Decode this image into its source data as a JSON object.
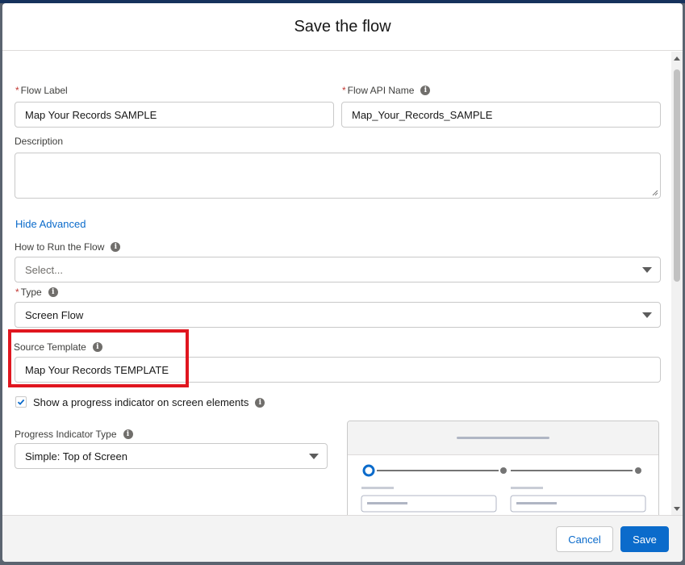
{
  "modal": {
    "title": "Save the flow"
  },
  "form": {
    "flow_label": {
      "label": "Flow Label",
      "required_marker": "*",
      "value": "Map Your Records SAMPLE"
    },
    "flow_api_name": {
      "label": "Flow API Name",
      "required_marker": "*",
      "value": "Map_Your_Records_SAMPLE"
    },
    "description": {
      "label": "Description",
      "value": ""
    },
    "advanced_link": "Hide Advanced",
    "how_to_run": {
      "label": "How to Run the Flow",
      "placeholder": "Select..."
    },
    "type": {
      "label": "Type",
      "required_marker": "*",
      "value": "Screen Flow"
    },
    "source_template": {
      "label": "Source Template",
      "value": "Map Your Records TEMPLATE"
    },
    "progress_checkbox": {
      "label": "Show a progress indicator on screen elements",
      "checked": true
    },
    "progress_type": {
      "label": "Progress Indicator Type",
      "value": "Simple: Top of Screen"
    }
  },
  "footer": {
    "cancel_label": "Cancel",
    "save_label": "Save"
  },
  "icons": {
    "info": "info-icon",
    "check": "checkmark-icon",
    "dropdown": "chevron-down-icon"
  },
  "colors": {
    "brand": "#0b6bcb",
    "highlight": "#e0161f",
    "required": "#c23934"
  }
}
